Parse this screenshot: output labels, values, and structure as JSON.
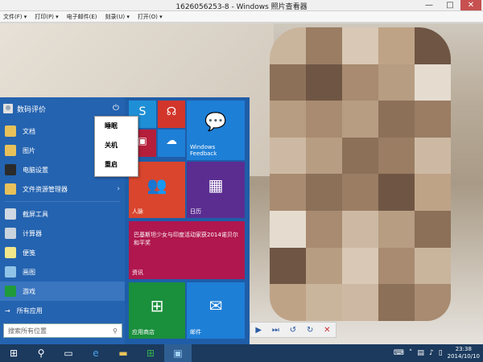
{
  "window": {
    "title": "1626056253-8 - Windows 照片查看器",
    "minimize": "—",
    "maximize": "□",
    "close": "✕"
  },
  "menubar": [
    "文件(F) ▾",
    "打印(P) ▾",
    "电子邮件(E)",
    "刻录(U) ▾",
    "打开(O) ▾"
  ],
  "start_menu": {
    "user_name": "数码评价",
    "items": [
      {
        "label": "文档",
        "icon": "folder-icon",
        "color": "#e8c15a"
      },
      {
        "label": "图片",
        "icon": "pictures-icon",
        "color": "#e8c15a"
      },
      {
        "label": "电脑设置",
        "icon": "gear-icon",
        "color": "#2b2b2b"
      },
      {
        "label": "文件资源管理器",
        "icon": "file-explorer-icon",
        "color": "#e8c15a",
        "arrow": "›"
      },
      {
        "label": "截屏工具",
        "icon": "snipping-tool-icon",
        "color": "#cfd8e3"
      },
      {
        "label": "计算器",
        "icon": "calculator-icon",
        "color": "#c9d3dd"
      },
      {
        "label": "便笺",
        "icon": "sticky-notes-icon",
        "color": "#f2e58a"
      },
      {
        "label": "画图",
        "icon": "paint-icon",
        "color": "#8fc4e8"
      },
      {
        "label": "游戏",
        "icon": "games-icon",
        "color": "#1f9b3a"
      }
    ],
    "all_apps": "所有应用",
    "search_placeholder": "搜索所有位置",
    "power_menu": [
      "睡眠",
      "关机",
      "重启"
    ]
  },
  "tiles": {
    "windows_feedback": "Windows Feedback",
    "people": "人脉",
    "calendar": "日历",
    "news_headline": "巴基斯坦少女与印度活动家获2014诺贝尔和平奖",
    "news": "资讯",
    "store": "应用商店",
    "mail": "邮件"
  },
  "taskbar": {
    "time": "23:38",
    "date": "2014/10/10"
  },
  "colors": {
    "start_bg": "#1f5da8",
    "tile_red": "#c0392b",
    "tile_purple": "#5b2d91",
    "tile_magenta": "#b0174e",
    "tile_green": "#1a8f3c",
    "tile_blue": "#1e7fd6"
  }
}
